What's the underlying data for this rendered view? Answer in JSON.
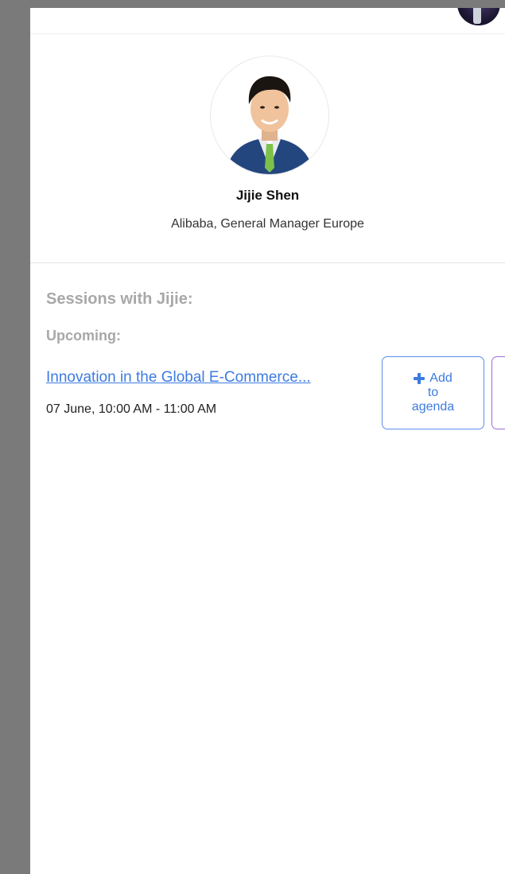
{
  "speaker": {
    "name": "Jijie Shen",
    "role": "Alibaba, General Manager Europe"
  },
  "sessions": {
    "heading": "Sessions with Jijie:",
    "upcoming_label": "Upcoming:",
    "items": [
      {
        "title": "Innovation in the Global E-Commerce...",
        "time": "07 June, 10:00 AM - 11:00 AM",
        "add_button": {
          "line1": "Add",
          "line2": "to",
          "line3": "agenda"
        }
      }
    ]
  },
  "colors": {
    "link": "#3d7be0",
    "heading_gray": "#a8a8a8",
    "add_button_border": "#5a8fe6",
    "secondary_button_border": "#9b6fd6"
  },
  "icons": {
    "add_button_icon": "plus-icon"
  }
}
